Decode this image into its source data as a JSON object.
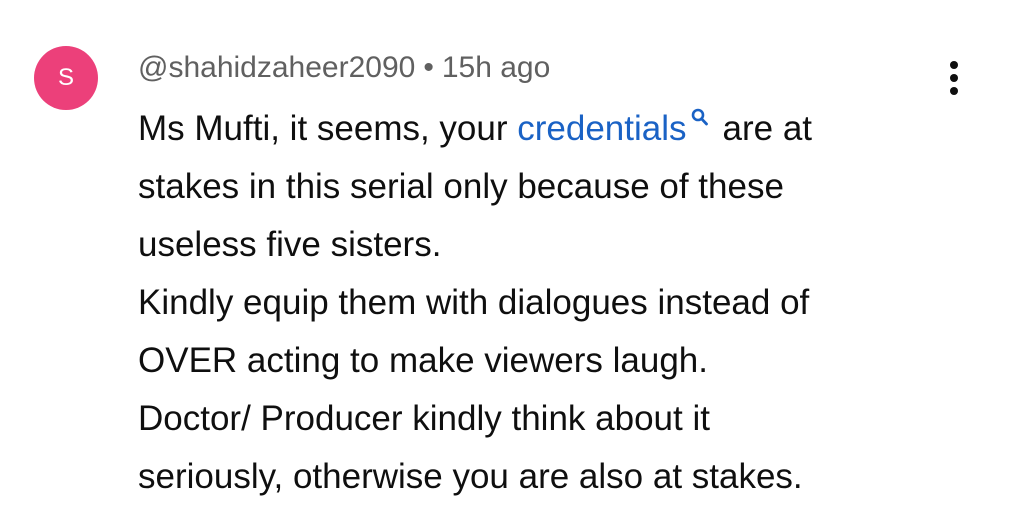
{
  "comment": {
    "avatar_letter": "S",
    "avatar_color": "#ec407a",
    "author": "@shahidzaheer2090",
    "separator": "•",
    "timestamp": "15h ago",
    "menu_icon": "more-vert-icon",
    "line1_before": "Ms Mufti, it seems, your ",
    "link_text": "credentials",
    "link_icon": "search-icon",
    "link_color": "#1a62c5",
    "line1_after": "are at",
    "line2": "stakes in this serial only because of these",
    "line3": "useless five sisters.",
    "line4": "Kindly equip them with dialogues instead of",
    "line5": "OVER acting to make viewers laugh.",
    "line6": "Doctor/ Producer kindly think about it",
    "line7": "seriously, otherwise you are also at stakes."
  }
}
